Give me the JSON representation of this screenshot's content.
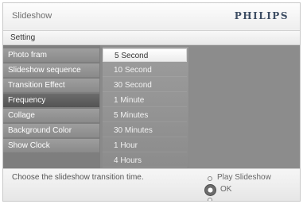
{
  "header": {
    "title": "Slideshow",
    "brand": "PHILIPS"
  },
  "section_heading": "Setting",
  "menu": {
    "items": [
      {
        "label": "Photo fram"
      },
      {
        "label": "Slideshow sequence"
      },
      {
        "label": "Transition Effect"
      },
      {
        "label": "Frequency"
      },
      {
        "label": "Collage"
      },
      {
        "label": "Background Color"
      },
      {
        "label": "Show Clock"
      }
    ],
    "selected_index": 3
  },
  "options": {
    "items": [
      {
        "label": "5 Second"
      },
      {
        "label": "10 Second"
      },
      {
        "label": "30 Second"
      },
      {
        "label": "1 Minute"
      },
      {
        "label": "5 Minutes"
      },
      {
        "label": "30 Minutes"
      },
      {
        "label": "1 Hour"
      },
      {
        "label": "4 Hours"
      }
    ],
    "selected_index": 0
  },
  "footer": {
    "hint": "Choose the slideshow transition time.",
    "play_label": "Play Slideshow",
    "ok_label": "OK"
  },
  "colors": {
    "brand": "#3d4d63",
    "selected_menu": "#5c5c5c",
    "panel": "#8a8a8a"
  }
}
